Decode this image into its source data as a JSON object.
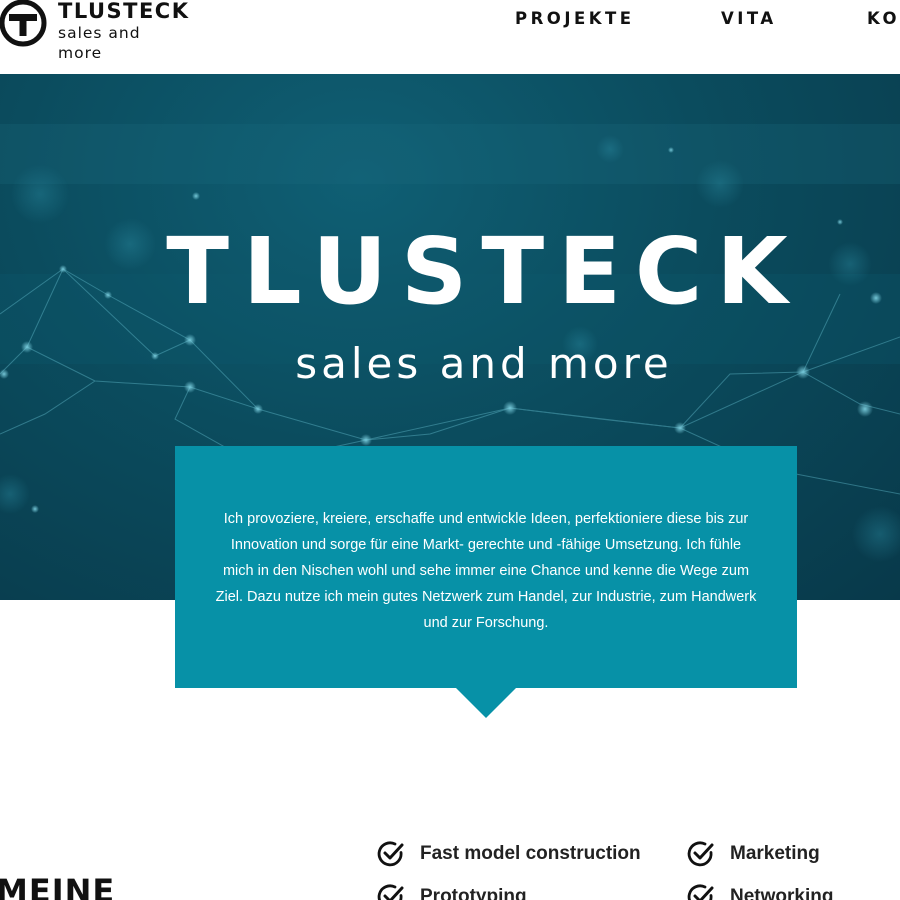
{
  "brand": {
    "name": "TLUSTECK",
    "tagline": "sales and more"
  },
  "nav": {
    "items": [
      "PROJEKTE",
      "VITA",
      "KO"
    ]
  },
  "hero": {
    "title": "TLUSTECK",
    "subtitle": "sales and more"
  },
  "intro": {
    "text": "Ich provoziere, kreiere, erschaffe und entwickle Ideen, perfektioniere diese bis zur Innovation und sorge für eine Markt- gerechte und -fähige Umsetzung. Ich fühle mich in den Nischen wohl und sehe immer eine Chance und kenne die Wege zum Ziel. Dazu nutze ich mein gutes Netzwerk zum Handel, zur Industrie, zum Handwerk und zur Forschung."
  },
  "section": {
    "title": "MEINE"
  },
  "features": [
    {
      "label": "Fast model construction",
      "icon": "check-circle-icon"
    },
    {
      "label": "Marketing",
      "icon": "check-circle-icon"
    },
    {
      "label": "Prototyping",
      "icon": "check-circle-icon"
    },
    {
      "label": "Networking",
      "icon": "check-circle-icon"
    }
  ],
  "colors": {
    "hero_background": "#0b4c5e",
    "intro_box": "#0791a7",
    "text_dark": "#111111"
  }
}
